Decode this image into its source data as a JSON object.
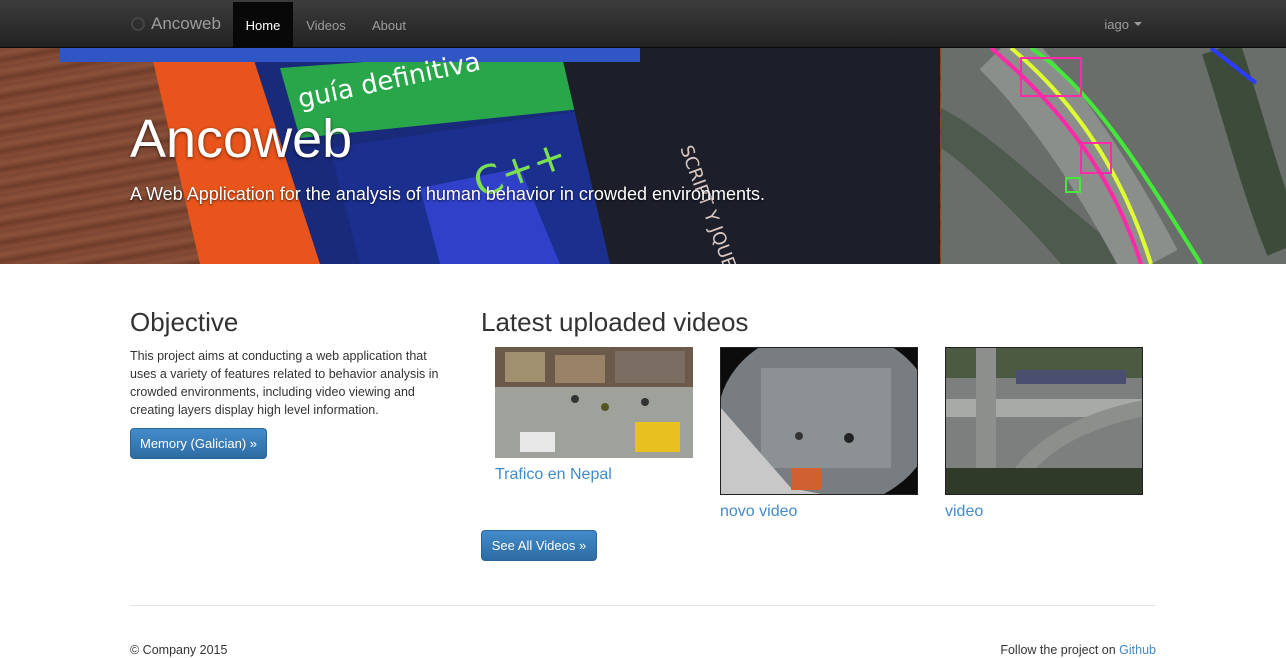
{
  "navbar": {
    "brand": "Ancoweb",
    "items": [
      {
        "label": "Home",
        "active": true
      },
      {
        "label": "Videos",
        "active": false
      },
      {
        "label": "About",
        "active": false
      }
    ],
    "user": "iago"
  },
  "hero": {
    "title": "Ancoweb",
    "subtitle": "A Web Application for the analysis of human behavior in crowded environments."
  },
  "objective": {
    "heading": "Objective",
    "text": "This project aims at conducting a web application that uses a variety of features related to behavior analysis in crowded environments, including video viewing and creating layers display high level information.",
    "button": "Memory (Galician) »"
  },
  "videos": {
    "heading": "Latest uploaded videos",
    "items": [
      {
        "title": "Trafico en Nepal"
      },
      {
        "title": "novo video"
      },
      {
        "title": "video"
      }
    ],
    "see_all": "See All Videos »"
  },
  "footer": {
    "copyright": "© Company 2015",
    "follow_text": "Follow the project on",
    "github": "Github"
  },
  "colors": {
    "primary": "#428bca",
    "navbar": "#222222",
    "link": "#428bca"
  }
}
